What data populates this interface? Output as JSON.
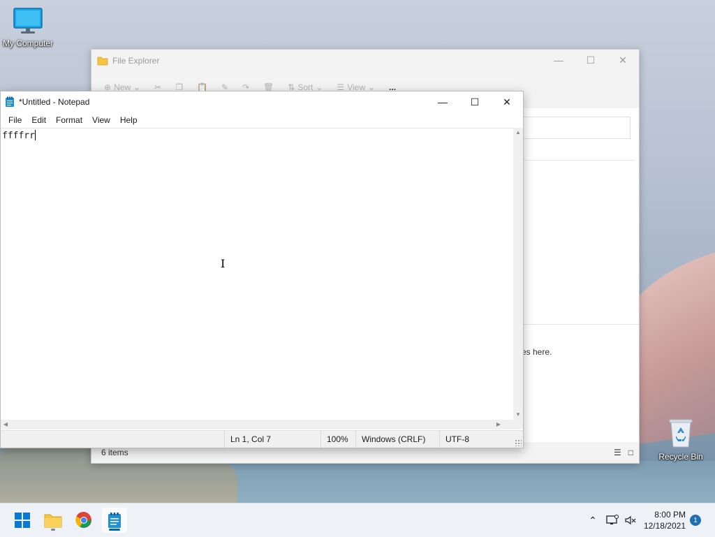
{
  "desktop": {
    "icons": [
      {
        "label": "My Computer"
      },
      {
        "label": "Recycle Bin"
      }
    ]
  },
  "file_explorer": {
    "title": "File Explorer",
    "toolbar": {
      "new_label": "New",
      "sort_label": "Sort",
      "view_label": "View",
      "more_label": "..."
    },
    "empty_text": "es here.",
    "status_count": "6 items"
  },
  "notepad": {
    "title": "*Untitled - Notepad",
    "menu": [
      "File",
      "Edit",
      "Format",
      "View",
      "Help"
    ],
    "content": "ffffrr",
    "status": {
      "position": "Ln 1, Col 7",
      "zoom": "100%",
      "line_ending": "Windows (CRLF)",
      "encoding": "UTF-8"
    }
  },
  "taskbar": {
    "time": "8:00 PM",
    "date": "12/18/2021",
    "notification_count": "1"
  },
  "colors": {
    "accent": "#0067c0",
    "notepad_icon": "#1f8fd6"
  }
}
